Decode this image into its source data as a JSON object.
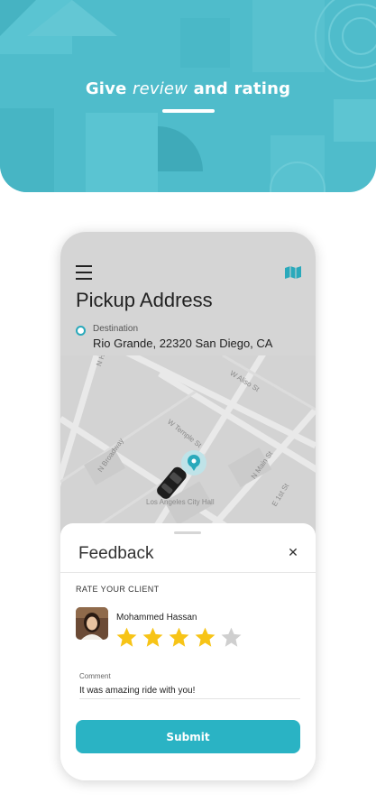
{
  "banner": {
    "headline_part1": "Give",
    "headline_em": "review",
    "headline_part2": "and rating",
    "background_color": "#4fbccb"
  },
  "app": {
    "menu_icon": "hamburger-menu-icon",
    "map_icon": "map-icon",
    "title": "Pickup Address",
    "destination_label": "Destination",
    "destination_value": "Rio Grande, 22320 San Diego, CA"
  },
  "map": {
    "streets": [
      "N Hill St",
      "W Aliso St",
      "W Temple St",
      "N Broadway",
      "N Main St",
      "Los Angeles City Hall",
      "E 1st St"
    ],
    "car_icon": "car-icon",
    "pin_icon": "location-pin-icon"
  },
  "feedback": {
    "title": "Feedback",
    "close_icon": "close-icon",
    "rate_label": "RATE YOUR CLIENT",
    "client_name": "Mohammed Hassan",
    "rating": 4,
    "max_rating": 5,
    "comment_label": "Comment",
    "comment_value": "It was amazing ride with you!",
    "submit_label": "Submit",
    "accent_color": "#2ab3c4",
    "star_color": "#f7c417"
  }
}
